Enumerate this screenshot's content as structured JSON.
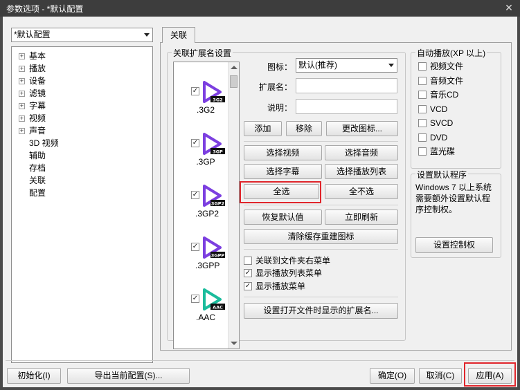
{
  "window": {
    "title": "参数选项 - *默认配置",
    "close_glyph": "✕"
  },
  "profile_select": {
    "value": "*默认配置"
  },
  "tree": {
    "items": [
      {
        "label": "基本",
        "expandable": true
      },
      {
        "label": "播放",
        "expandable": true
      },
      {
        "label": "设备",
        "expandable": true
      },
      {
        "label": "滤镜",
        "expandable": true
      },
      {
        "label": "字幕",
        "expandable": true
      },
      {
        "label": "视频",
        "expandable": true
      },
      {
        "label": "声音",
        "expandable": true
      },
      {
        "label": "3D 视频",
        "expandable": false
      },
      {
        "label": "辅助",
        "expandable": false
      },
      {
        "label": "存档",
        "expandable": false
      },
      {
        "label": "关联",
        "expandable": false
      },
      {
        "label": "配置",
        "expandable": false
      }
    ]
  },
  "tab": {
    "label": "关联"
  },
  "assoc": {
    "group_title": "关联扩展名设置",
    "file_types": [
      {
        "ext": ".3G2",
        "badge": "3G2",
        "checked": true,
        "color": "#7c3fe0"
      },
      {
        "ext": ".3GP",
        "badge": "3GP",
        "checked": true,
        "color": "#7c3fe0"
      },
      {
        "ext": ".3GP2",
        "badge": "3GP2",
        "checked": true,
        "color": "#7c3fe0"
      },
      {
        "ext": ".3GPP",
        "badge": "3GPP",
        "checked": true,
        "color": "#7c3fe0"
      },
      {
        "ext": ".AAC",
        "badge": "AAC",
        "checked": true,
        "color": "#1abc9c"
      }
    ],
    "icon_label": "图标：",
    "icon_value": "默认(推荐)",
    "ext_label": "扩展名：",
    "desc_label": "说明：",
    "add": "添加",
    "remove": "移除",
    "change_icon": "更改图标...",
    "select_video": "选择视频",
    "select_audio": "选择音频",
    "select_subtitle": "选择字幕",
    "select_playlist": "选择播放列表",
    "select_all": "全选",
    "select_none": "全不选",
    "restore_default": "恢复默认值",
    "refresh_now": "立即刷新",
    "clear_cache": "清除缓存重建图标",
    "opt_folder_menu": {
      "label": "关联到文件夹右菜单",
      "checked": false
    },
    "opt_playlist_menu": {
      "label": "显示播放列表菜单",
      "checked": true
    },
    "opt_play_menu": {
      "label": "显示播放菜单",
      "checked": true
    },
    "set_open_ext": "设置打开文件时显示的扩展名..."
  },
  "autoplay": {
    "title": "自动播放(XP 以上)",
    "items": [
      {
        "label": "视频文件",
        "checked": false
      },
      {
        "label": "音频文件",
        "checked": false
      },
      {
        "label": "音乐CD",
        "checked": false
      },
      {
        "label": "VCD",
        "checked": false
      },
      {
        "label": "SVCD",
        "checked": false
      },
      {
        "label": "DVD",
        "checked": false
      },
      {
        "label": "蓝光碟",
        "checked": false
      }
    ]
  },
  "default_program": {
    "title": "设置默认程序",
    "text": "Windows 7 以上系统需要额外设置默认程序控制权。",
    "button": "设置控制权"
  },
  "footer": {
    "init": "初始化(I)",
    "export": "导出当前配置(S)...",
    "ok": "确定(O)",
    "cancel": "取消(C)",
    "apply": "应用(A)"
  },
  "colors": {
    "highlight": "#e0252b"
  }
}
